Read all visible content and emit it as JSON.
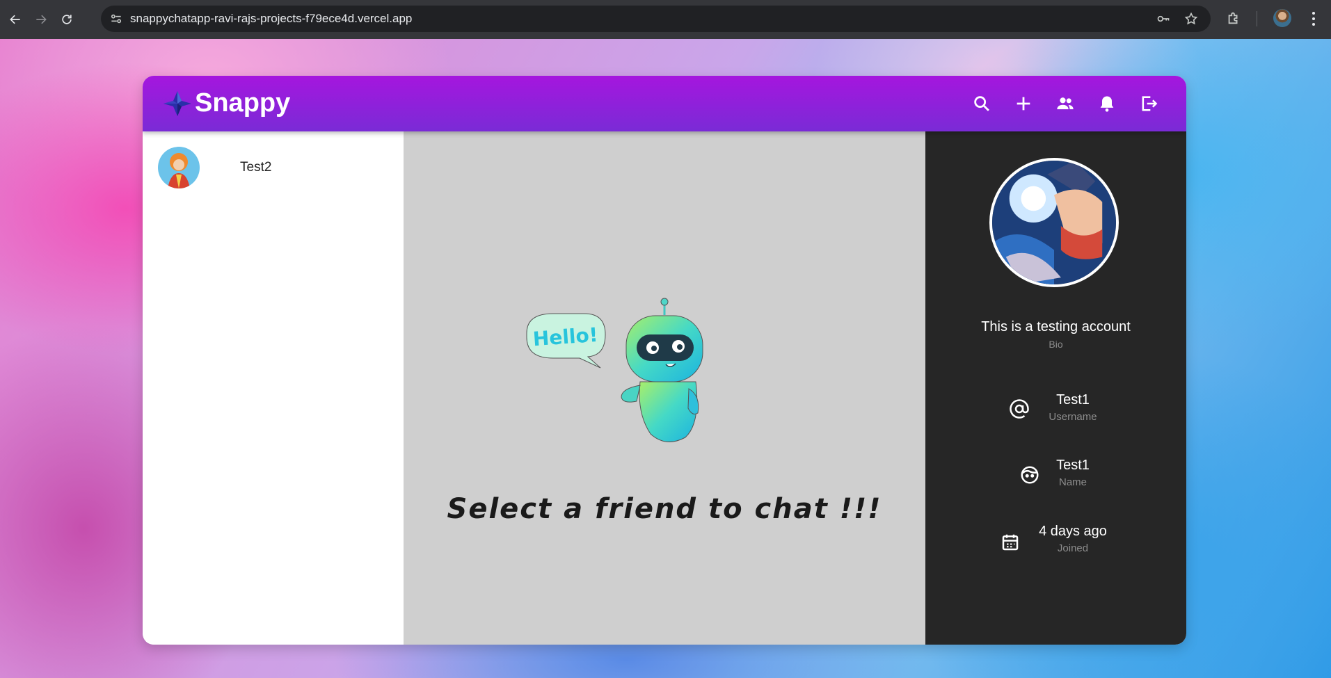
{
  "browser": {
    "url": "snappychatapp-ravi-rajs-projects-f79ece4d.vercel.app"
  },
  "header": {
    "brand": "Snappy",
    "icons": [
      "search-icon",
      "add-icon",
      "group-icon",
      "notifications-icon",
      "logout-icon"
    ]
  },
  "sidebar": {
    "contacts": [
      {
        "name": "Test2"
      }
    ]
  },
  "chat": {
    "bubble_text": "Hello!",
    "welcome": "Select a friend to chat !!!"
  },
  "profile": {
    "bio": "This is a testing account",
    "bio_label": "Bio",
    "username": "Test1",
    "username_label": "Username",
    "name": "Test1",
    "name_label": "Name",
    "joined": "4 days ago",
    "joined_label": "Joined"
  },
  "colors": {
    "header_start": "#a516de",
    "header_end": "#7a2bd6",
    "chat_bg": "#cfcfcf",
    "profile_bg": "#262626"
  }
}
